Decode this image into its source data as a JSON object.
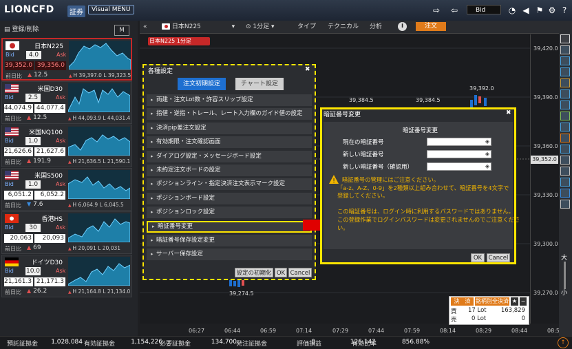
{
  "app": {
    "brand": "LIONCFD",
    "brand_sub": "証券",
    "visual_menu": "Visual MENU",
    "price_mode": "Bid"
  },
  "left_panel": {
    "register_label": "登録/削除",
    "m_button": "M",
    "bid_label": "Bid",
    "ask_label": "Ask",
    "prev_label": "前日比",
    "cards": [
      {
        "name": "日本N225",
        "flag": "jp",
        "spread": "4.0",
        "bid": "39,352.0",
        "ask": "39,356.0",
        "change": "12.5",
        "dir": "up",
        "high": "H 39,397.0",
        "low": "L 39,323.5",
        "selected": true
      },
      {
        "name": "米国D30",
        "flag": "us",
        "spread": "2.5",
        "bid": "44,074.9",
        "ask": "44,077.4",
        "change": "12.5",
        "dir": "up",
        "high": "H 44,093.9",
        "low": "L 44,031.4",
        "selected": false
      },
      {
        "name": "米国NQ100",
        "flag": "us",
        "spread": "1.0",
        "bid": "21,626.6",
        "ask": "21,627.6",
        "change": "191.9",
        "dir": "up",
        "high": "H 21,636.5",
        "low": "L 21,590.1",
        "selected": false
      },
      {
        "name": "米国S500",
        "flag": "us",
        "spread": "1.0",
        "bid": "6,051.2",
        "ask": "6,052.2",
        "change": "7.6",
        "dir": "down",
        "high": "H 6,064.9",
        "low": "L 6,045.5",
        "selected": false
      },
      {
        "name": "香港HS",
        "flag": "hk",
        "spread": "30",
        "bid": "20,063",
        "ask": "20,093",
        "change": "69",
        "dir": "up",
        "high": "H 20,091",
        "low": "L 20,031",
        "selected": false
      },
      {
        "name": "ドイツD30",
        "flag": "de",
        "spread": "10.0",
        "bid": "21,161.3",
        "ask": "21,171.3",
        "change": "26.2",
        "dir": "up",
        "high": "H 21,164.8",
        "low": "L 21,134.0",
        "selected": false
      }
    ]
  },
  "chart_toolbar": {
    "symbol": "日本N225",
    "timeframe": "1分足",
    "type_label": "タイプ",
    "technical_label": "テクニカル",
    "analysis_label": "分析",
    "info_label": "i",
    "order_label": "注文",
    "count": "4"
  },
  "chart": {
    "symbol_tag": "日本N225 1分足",
    "y_labels": [
      "39,420.0",
      "39,390.0",
      "39,360.0",
      "39,330.0",
      "39,300.0",
      "39,270.0"
    ],
    "current_price": "39,352.0",
    "x_labels": [
      "06:27",
      "06:44",
      "06:59",
      "07:14",
      "07:29",
      "07:44",
      "07:59",
      "08:14",
      "08:29",
      "08:44",
      "08:59"
    ],
    "annotations": [
      "39,384.5",
      "39,384.5",
      "39,392.0",
      "39,274.5"
    ]
  },
  "settings_dialog": {
    "title": "各種設定",
    "tab_order": "注文初期設定",
    "tab_chart": "チャート設定",
    "items": [
      "両建・注文Lot数・許容スリップ設定",
      "指値・逆指・トレール、レート入力欄のガイド値の設定",
      "決済pip差注文設定",
      "有効期限・注文確認画面",
      "ダイアログ設定・メッセージボード設定",
      "未約定注文ボードの設定",
      "ポジションライン・指定決済注文表示マーク設定",
      "ポジションボード設定",
      "ポジションロック設定",
      "暗証番号変更",
      "暗証番号保存設定変更",
      "サーバー保存設定"
    ],
    "highlighted_index": 9,
    "reset_label": "設定の初期化",
    "ok_label": "OK",
    "cancel_label": "Cancel"
  },
  "pin_dialog": {
    "title": "暗証番号変更",
    "subtitle": "暗証番号変更",
    "current_label": "現在の暗証番号",
    "new_label": "新しい暗証番号",
    "confirm_label": "新しい暗証番号（確認用）",
    "warnings": [
      "暗証番号の管理にはご注意ください。",
      "「a-z、A-Z、0-9」を2種類以上組み合わせて、暗証番号を4文字で",
      "登録してください。",
      "",
      "この暗証番号は、ログイン時に利用するパスワードではありません。",
      "この登録作業でログインパスワードは変更されませんのでご注意くださ",
      "い。"
    ],
    "ok_label": "OK",
    "cancel_label": "Cancel"
  },
  "position_panel": {
    "settle_label": "決　済",
    "settle_all_label": "銘柄別全決済",
    "buy_label": "買",
    "buy_lot": "17 Lot",
    "buy_value": "163,829",
    "sell_label": "売",
    "sell_lot": "0 Lot",
    "sell_value": "0"
  },
  "status_bar": {
    "items": [
      {
        "label": "預託証拠金",
        "value": "1,028,084"
      },
      {
        "label": "有効証拠金",
        "value": "1,154,226"
      },
      {
        "label": "必要証拠金",
        "value": "134,700"
      },
      {
        "label": "発注証拠金",
        "value": "0"
      },
      {
        "label": "評価損益",
        "value": "126,142"
      },
      {
        "label": "有効比率",
        "value": "856.88%"
      }
    ]
  },
  "side_zoom": {
    "zoom_in": "大",
    "zoom_out": "小"
  },
  "colors": {
    "accent": "#e07b1a",
    "highlight": "#ffe600",
    "selected": "#c62828",
    "tab_active": "#1e6fd0",
    "warning": "#f0b400"
  }
}
